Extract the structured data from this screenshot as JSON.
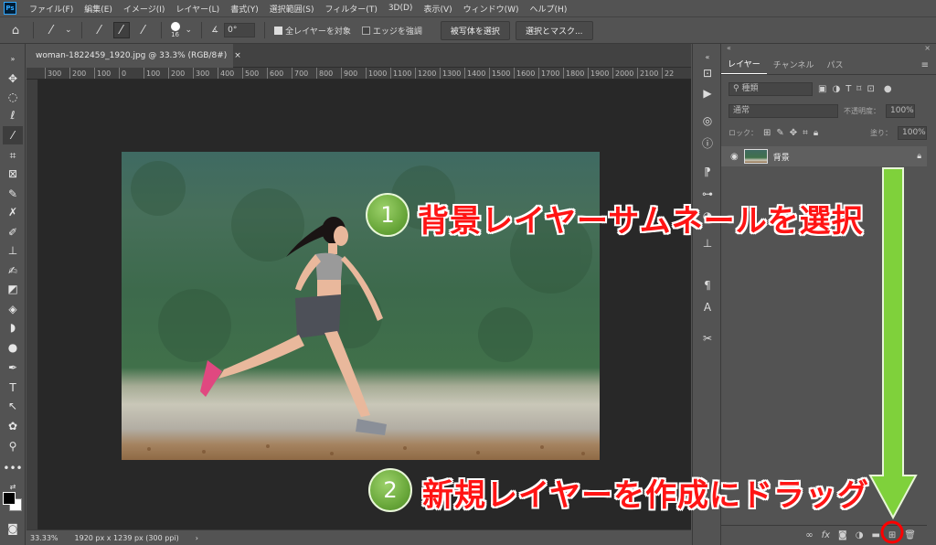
{
  "app": {
    "logo": "Ps"
  },
  "menu": [
    "ファイル(F)",
    "編集(E)",
    "イメージ(I)",
    "レイヤー(L)",
    "書式(Y)",
    "選択範囲(S)",
    "フィルター(T)",
    "3D(D)",
    "表示(V)",
    "ウィンドウ(W)",
    "ヘルプ(H)"
  ],
  "options": {
    "brush_size": "16",
    "angle_value": "0°",
    "sample_all_layers": "全レイヤーを対象",
    "enhance_edge": "エッジを強調",
    "select_subject": "被写体を選択",
    "select_and_mask": "選択とマスク..."
  },
  "document": {
    "tab_title": "woman-1822459_1920.jpg @ 33.3% (RGB/8#)",
    "close": "×",
    "ruler_ticks": [
      "300",
      "200",
      "100",
      "0",
      "100",
      "200",
      "300",
      "400",
      "500",
      "600",
      "700",
      "800",
      "900",
      "1000",
      "1100",
      "1200",
      "1300",
      "1400",
      "1500",
      "1600",
      "1700",
      "1800",
      "1900",
      "2000",
      "2100",
      "22"
    ]
  },
  "status": {
    "zoom": "33.33%",
    "doc_info": "1920 px x 1239 px (300 ppi)",
    "arrow": "›"
  },
  "panel": {
    "tabs": [
      "レイヤー",
      "チャンネル",
      "パス"
    ],
    "filter_kind": "種類",
    "blend_mode": "通常",
    "opacity_label": "不透明度：",
    "opacity_value": "100%",
    "lock_label": "ロック：",
    "fill_label": "塗り：",
    "fill_value": "100%",
    "layer_name": "背景"
  },
  "annotations": {
    "step1_number": "1",
    "step1_text": "背景レイヤーサムネールを選択",
    "step2_number": "2",
    "step2_text": "新規レイヤーを作成にドラッグ"
  },
  "colors": {
    "highlight_ring": "#ff0000",
    "arrow": "#7fd13b",
    "annotation_text": "#ff1414"
  }
}
